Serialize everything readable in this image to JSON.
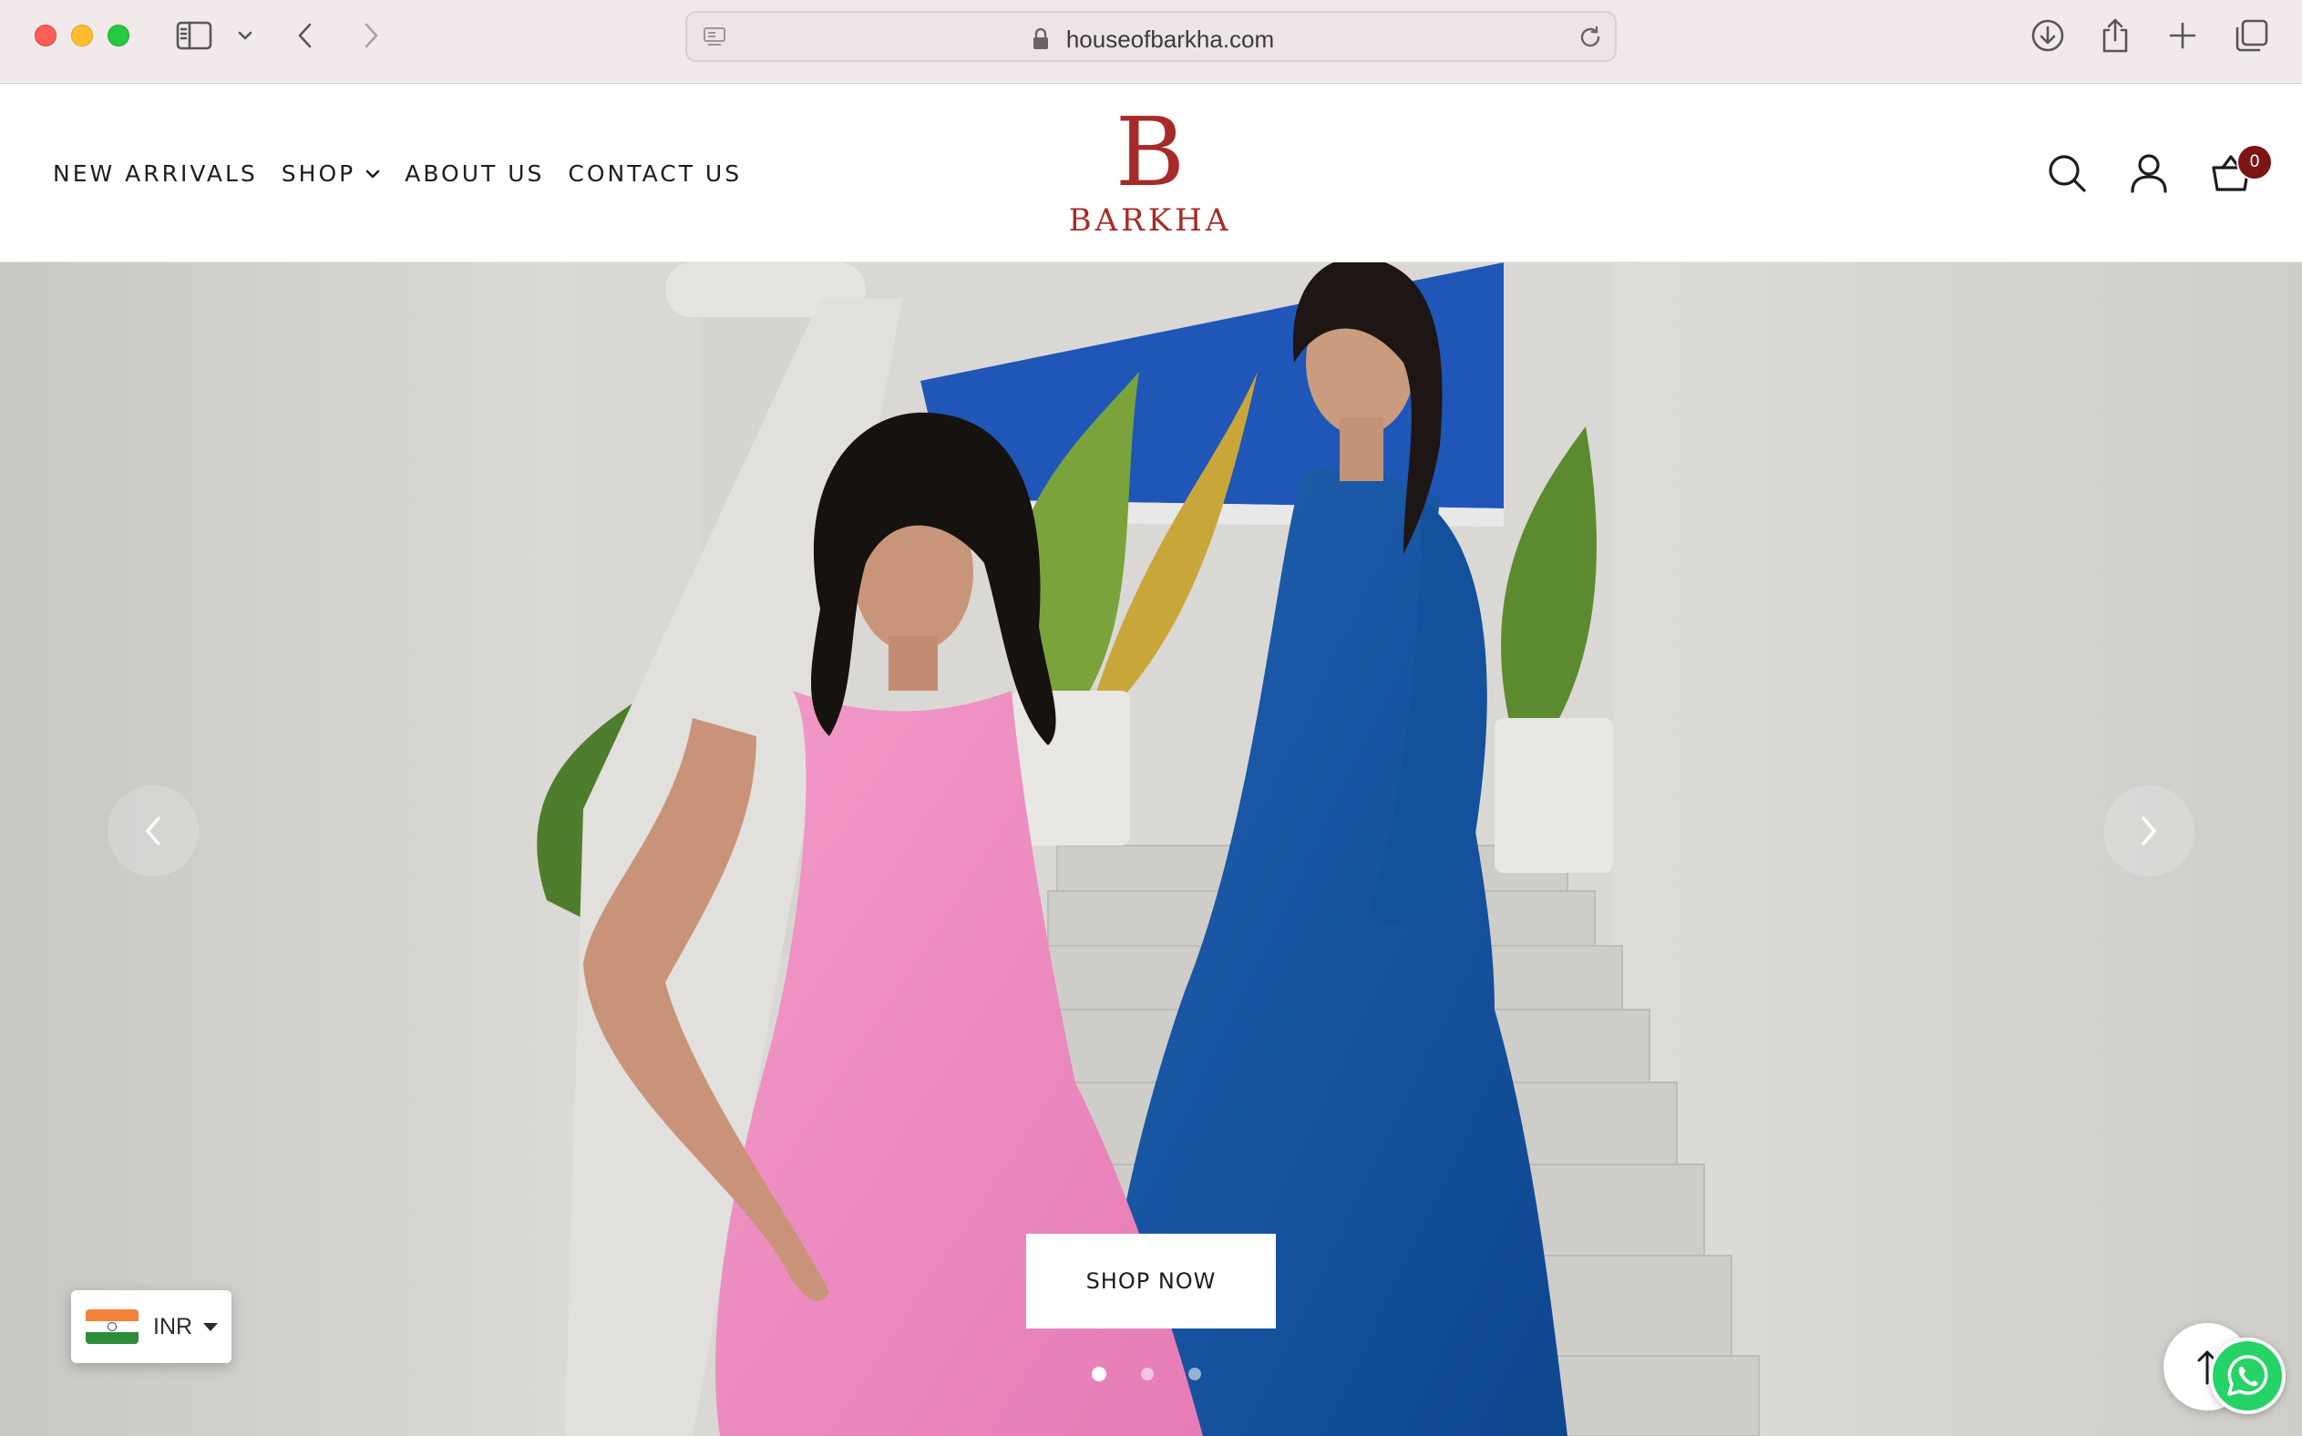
{
  "browser": {
    "url": "houseofbarkha.com",
    "icons": [
      "sidebar-icon",
      "chevron-down-icon",
      "back-icon",
      "forward-icon",
      "lock-icon",
      "reload-icon",
      "download-icon",
      "share-icon",
      "new-tab-icon",
      "tabs-overview-icon"
    ]
  },
  "header": {
    "nav": [
      {
        "label": "NEW ARRIVALS"
      },
      {
        "label": "SHOP",
        "has_dropdown": true
      },
      {
        "label": "ABOUT US"
      },
      {
        "label": "CONTACT US"
      }
    ],
    "logo": {
      "mark": "B",
      "text": "BARKHA",
      "color": "#a52a28"
    },
    "icons": [
      "search-icon",
      "account-icon",
      "cart-icon"
    ],
    "cart_count": "0",
    "cart_badge_color": "#7d1414"
  },
  "hero": {
    "cta_label": "SHOP NOW",
    "slides_count": 3,
    "active_slide": 1
  },
  "widgets": {
    "currency": {
      "code": "INR",
      "flag": "india-flag-icon"
    },
    "scroll_top_icon": "arrow-up-icon",
    "chat_icon": "whatsapp-icon"
  }
}
